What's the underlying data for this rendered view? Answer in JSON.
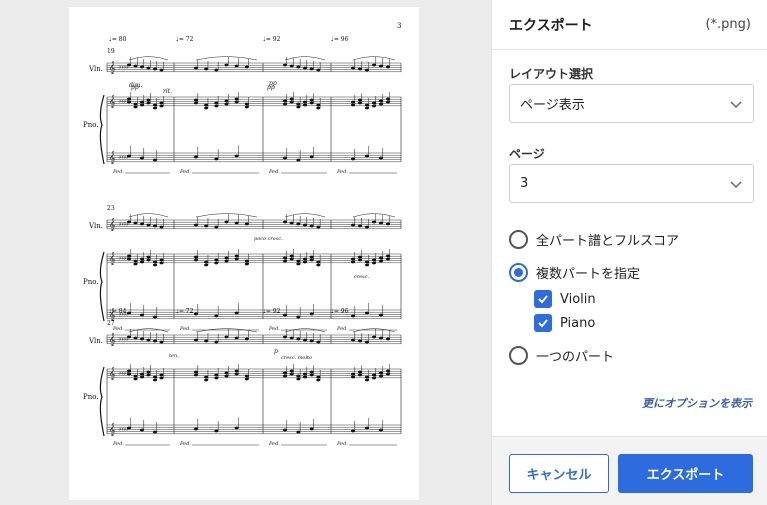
{
  "preview": {
    "page_number": "3",
    "systems": [
      {
        "measure_number": "19",
        "tempos": [
          "♩= 80",
          "♩= 72",
          "♩= 92",
          "♩= 96"
        ],
        "instrument_labels": [
          "Vln.",
          "Pno."
        ],
        "markings": [
          "dim.",
          "pp",
          "pp",
          "rit.",
          "pp"
        ]
      },
      {
        "measure_number": "23",
        "tempos": [],
        "instrument_labels": [
          "Vln.",
          "Pno."
        ],
        "markings": [
          "poco cresc.",
          "cresc."
        ]
      },
      {
        "measure_number": "27",
        "tempos": [
          "♩= 84",
          "♩= 72",
          "♩= 92",
          "♩= 96"
        ],
        "instrument_labels": [
          "Vln.",
          "Pno."
        ],
        "markings": [
          "ten.",
          "p",
          "cresc. molto"
        ]
      }
    ]
  },
  "panel": {
    "title": "エクスポート",
    "format": "(*.png)",
    "layout_label": "レイアウト選択",
    "layout_value": "ページ表示",
    "page_label": "ページ",
    "page_value": "3",
    "radio_all": "全パート譜とフルスコア",
    "radio_multi": "複数パートを指定",
    "part_violin": "Violin",
    "part_piano": "Piano",
    "radio_single": "一つのパート",
    "more_options": "更にオプションを表示",
    "cancel": "キャンセル",
    "export": "エクスポート",
    "selected_option": "複数パートを指定",
    "accent_color": "#2d6cdf"
  }
}
